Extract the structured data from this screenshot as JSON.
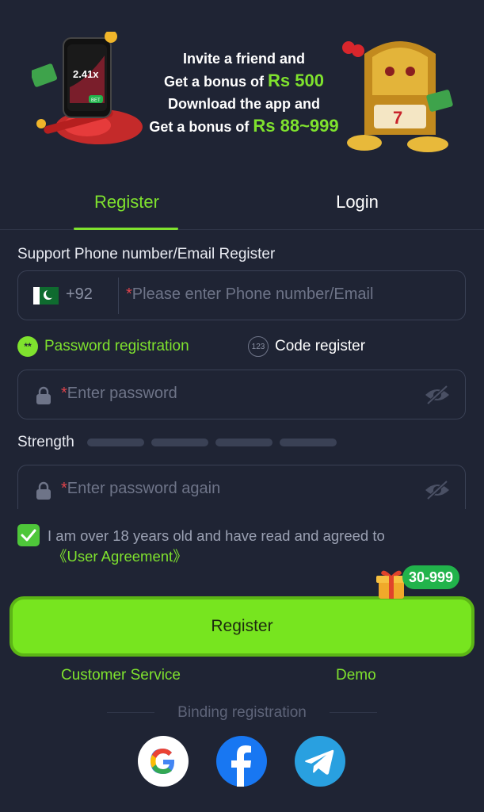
{
  "banner": {
    "line1": "Invite a friend and",
    "line2_prefix": "Get a bonus of ",
    "line2_amount": "Rs 500",
    "line3": "Download the app and",
    "line4_prefix": "Get a bonus of ",
    "line4_amount": "Rs 88~999",
    "phone_multiplier": "2.41x",
    "phone_button": "BET"
  },
  "tabs": {
    "register": "Register",
    "login": "Login",
    "active": "register"
  },
  "form": {
    "section_label": "Support Phone number/Email Register",
    "phone": {
      "country_code": "+92",
      "required_mark": "*",
      "placeholder": "Please enter Phone number/Email"
    },
    "options": {
      "password_registration": "Password registration",
      "password_icon_text": "**",
      "code_register": "Code register",
      "code_icon_text": "123",
      "selected": "password_registration"
    },
    "password": {
      "required_mark": "*",
      "placeholder": "Enter password"
    },
    "strength": {
      "label": "Strength",
      "level": 0,
      "segments": 4
    },
    "password_again": {
      "required_mark": "*",
      "placeholder": "Enter password again"
    },
    "agreement": {
      "checked": true,
      "text": "I am over 18 years old and have read and agreed to",
      "link": "《User Agreement》"
    }
  },
  "register_button": {
    "label": "Register",
    "bonus_badge": "30-999"
  },
  "links": {
    "customer_service": "Customer Service",
    "demo": "Demo"
  },
  "binding": {
    "label": "Binding registration",
    "providers": [
      "google-icon",
      "facebook-icon",
      "telegram-icon"
    ]
  },
  "colors": {
    "background": "#1f2434",
    "accent": "#7fe22e",
    "button": "#77e51f",
    "required": "#e0434b",
    "badge": "#21b34b"
  }
}
